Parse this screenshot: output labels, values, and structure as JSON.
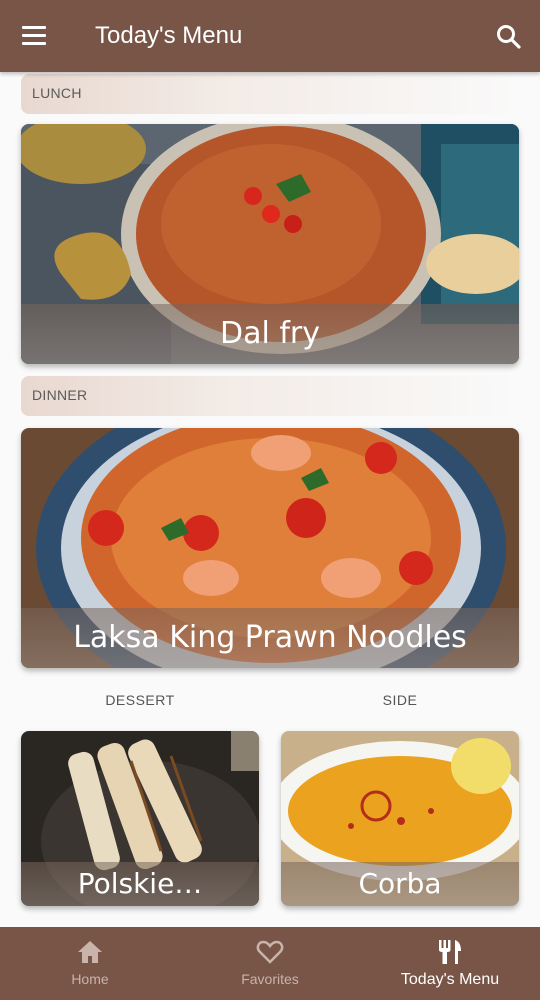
{
  "appbar": {
    "title": "Today's Menu"
  },
  "sections": {
    "lunch": {
      "label": "LUNCH",
      "dish": "Dal fry"
    },
    "dinner": {
      "label": "DINNER",
      "dish": "Laksa King Prawn Noodles"
    },
    "dessert": {
      "label": "DESSERT",
      "dish": "Polskie…"
    },
    "side": {
      "label": "SIDE",
      "dish": "Corba"
    }
  },
  "bottom_nav": {
    "items": [
      {
        "label": "Home",
        "icon": "home-icon",
        "active": false
      },
      {
        "label": "Favorites",
        "icon": "heart-icon",
        "active": false
      },
      {
        "label": "Today's Menu",
        "icon": "restaurant-icon",
        "active": true
      }
    ]
  },
  "colors": {
    "primary": "#795548",
    "inactive_nav": "#c8b4ab",
    "background": "#fafafa"
  }
}
